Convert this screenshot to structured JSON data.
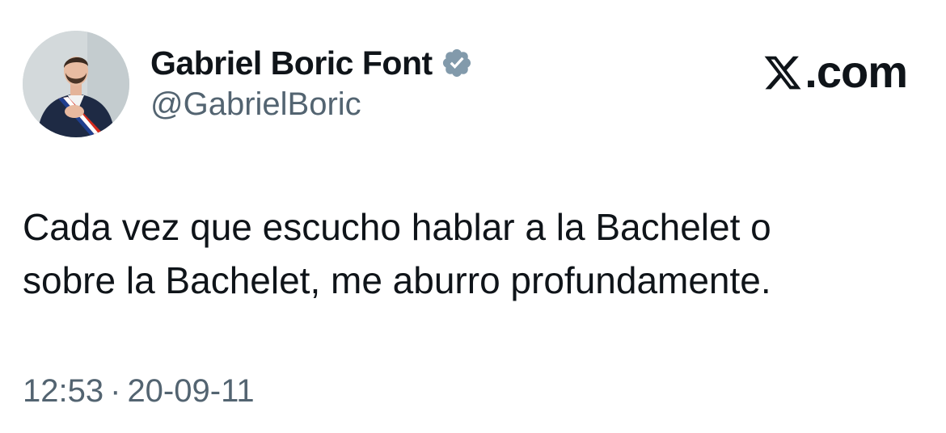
{
  "author": {
    "display_name": "Gabriel Boric Font",
    "handle": "@GabrielBoric",
    "verified_icon": "verified-badge-icon"
  },
  "site_logo": {
    "text": ".com",
    "icon": "x-logo-icon"
  },
  "tweet": {
    "lines": [
      "Cada vez que escucho hablar a la Bachelet o",
      "sobre la Bachelet, me aburro profundamente."
    ]
  },
  "meta": {
    "time": "12:53",
    "separator": "·",
    "date": "20-09-11"
  },
  "colors": {
    "text": "#0f1419",
    "secondary": "#536471",
    "verified": "#829aab",
    "background": "#ffffff"
  }
}
